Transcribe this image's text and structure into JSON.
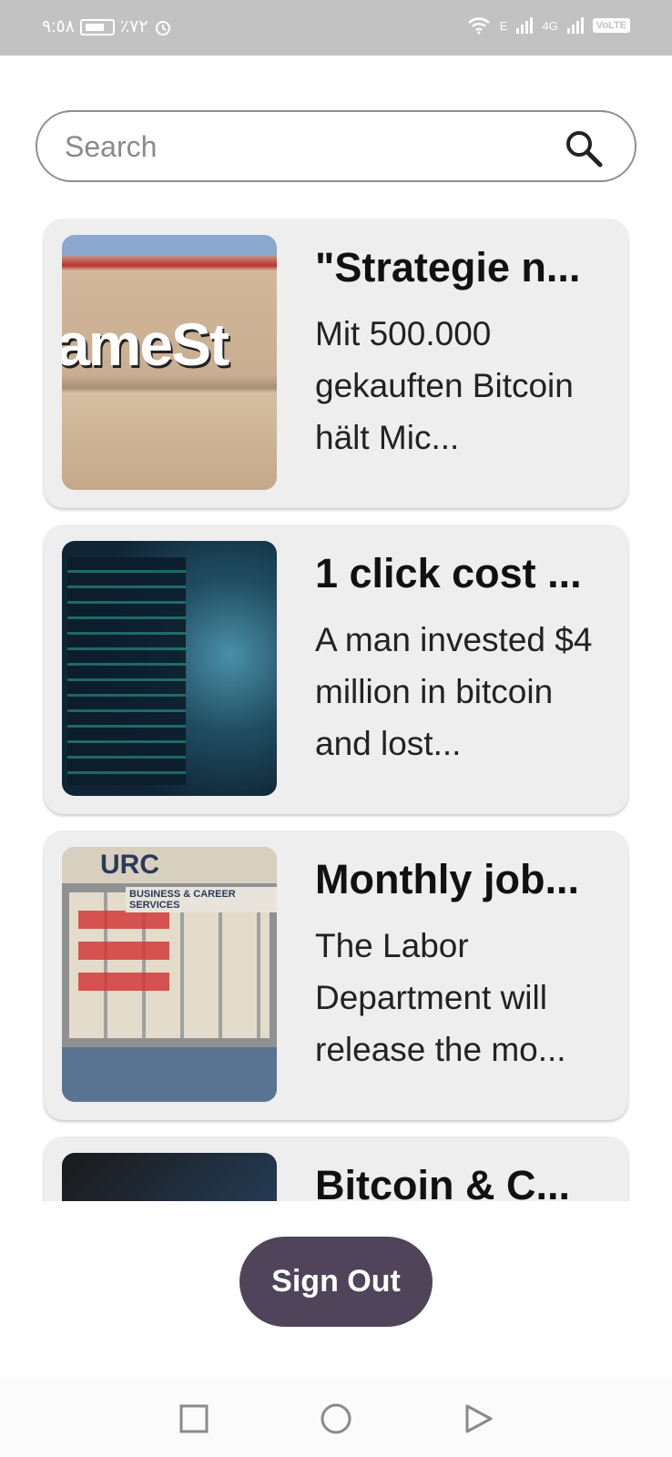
{
  "status_bar": {
    "time": "٩:٥٨",
    "battery": "٪٧٢",
    "network": "4G",
    "volte": "VoLTE",
    "carrier_small": "E"
  },
  "search": {
    "placeholder": "Search",
    "value": ""
  },
  "articles": [
    {
      "title": "\"Strategie n...",
      "description": "Mit 500.000 gekauften Bitcoin hält Mic...",
      "image_text": "ameSt"
    },
    {
      "title": "1 click cost ...",
      "description": "A man invested $4 million in bitcoin and lost...",
      "image_text": ""
    },
    {
      "title": "Monthly job...",
      "description": "The Labor Department will release the mo...",
      "image_text": "BUSINESS & CAREER SERVICES"
    },
    {
      "title": "Bitcoin & C...",
      "description": "",
      "image_text": ""
    }
  ],
  "signout_label": "Sign Out",
  "colors": {
    "status_bar": "#c2c2c2",
    "card_bg": "#eeeeee",
    "signout_bg": "#4f4459",
    "search_border": "#8e8e8e"
  }
}
